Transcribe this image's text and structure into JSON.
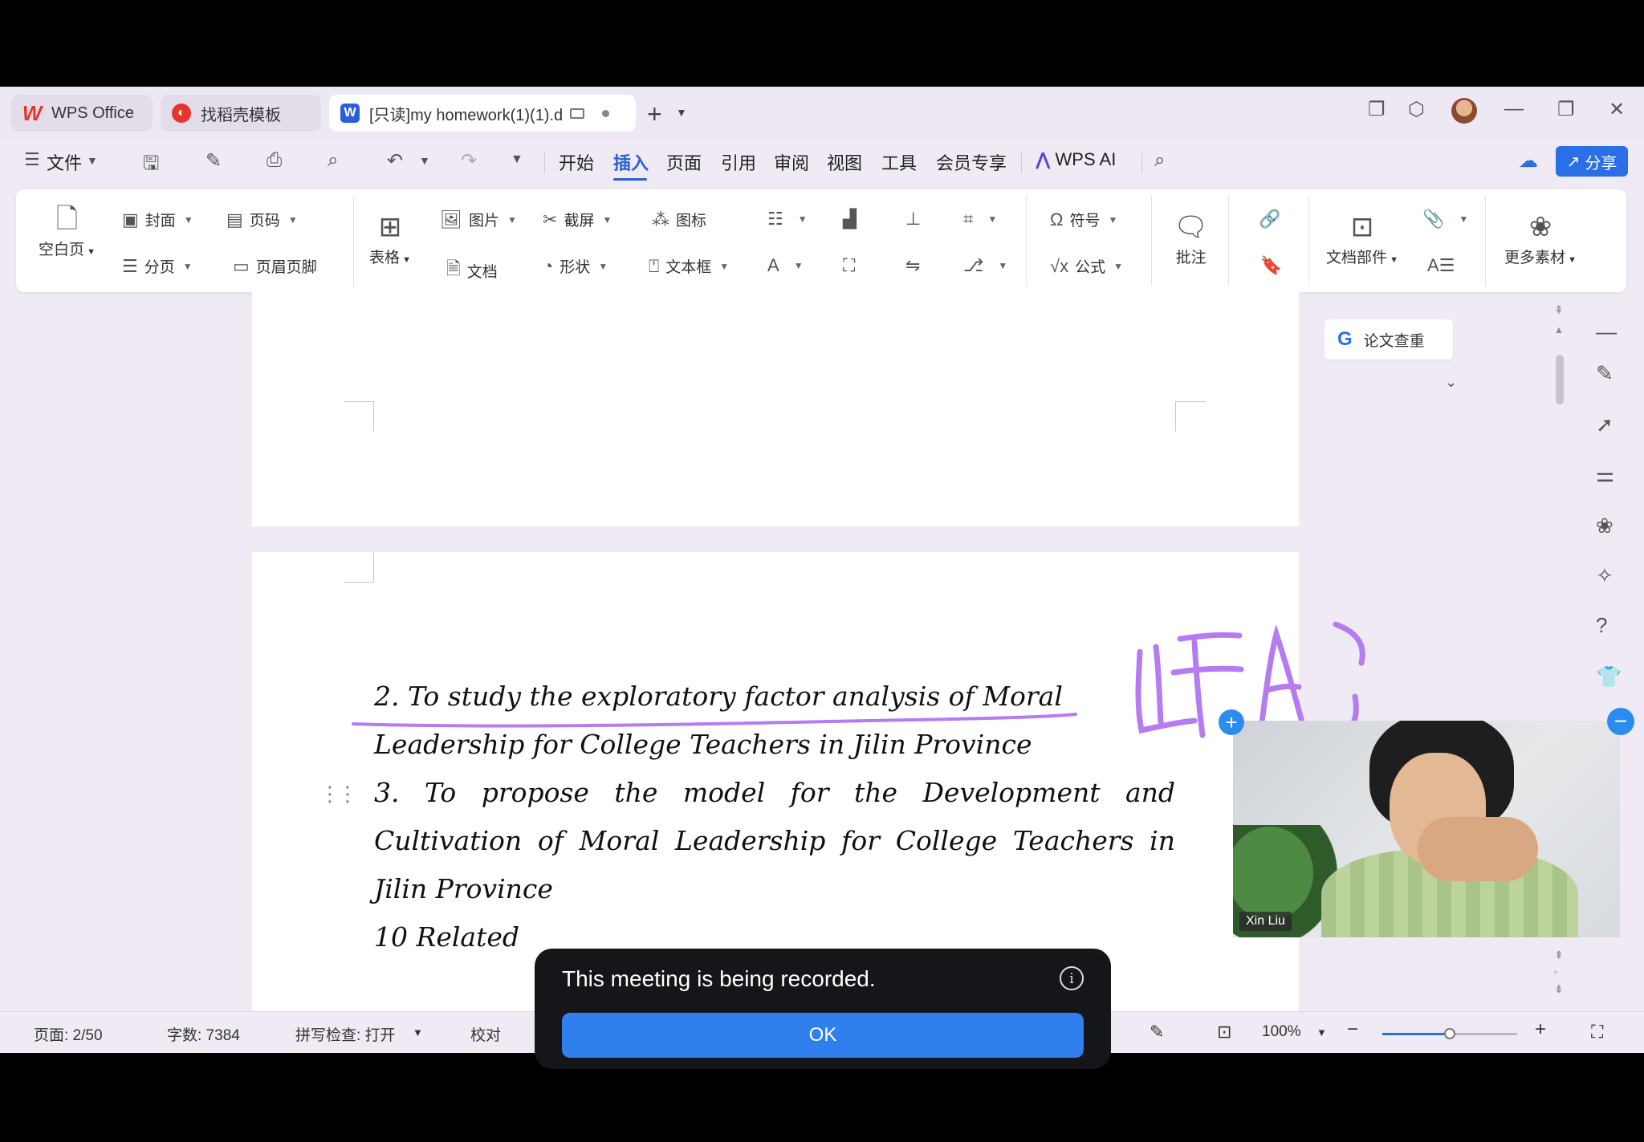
{
  "tabs": {
    "wps": "WPS Office",
    "template": "找稻壳模板",
    "doc": "[只读]my homework(1)(1).d"
  },
  "menu": {
    "file": "文件",
    "items": [
      "开始",
      "插入",
      "页面",
      "引用",
      "审阅",
      "视图",
      "工具",
      "会员专享"
    ],
    "wps_ai": "WPS AI",
    "share": "分享"
  },
  "ribbon": {
    "blank_page": "空白页",
    "cover": "封面",
    "page_number": "页码",
    "section_break": "分页",
    "header_footer": "页眉页脚",
    "table": "表格",
    "picture": "图片",
    "document": "文档",
    "screenshot": "截屏",
    "shape": "形状",
    "icons": "图标",
    "textbox": "文本框",
    "symbol": "符号",
    "formula": "公式",
    "comment": "批注",
    "doc_parts": "文档部件",
    "more_materials": "更多素材"
  },
  "side": {
    "plagiarism": "论文查重"
  },
  "document": {
    "line2a": "2. To study the exploratory factor analysis of Moral",
    "line2b": "Leadership for College Teachers in Jilin Province",
    "line3": "3. To propose the model for the Development and Cultivation of Moral Leadership for College Teachers in Jilin Province",
    "line10": "10 Related"
  },
  "status": {
    "page": "页面: 2/50",
    "words": "字数: 7384",
    "spell": "拼写检查: 打开",
    "proof": "校对",
    "zoom": "100%",
    "zoom_level": 0.5
  },
  "video": {
    "name": "Xin Liu"
  },
  "toast": {
    "message": "This meeting is being recorded.",
    "ok": "OK"
  },
  "colors": {
    "accent": "#2b6fe6",
    "annotation": "#b57cf2"
  }
}
